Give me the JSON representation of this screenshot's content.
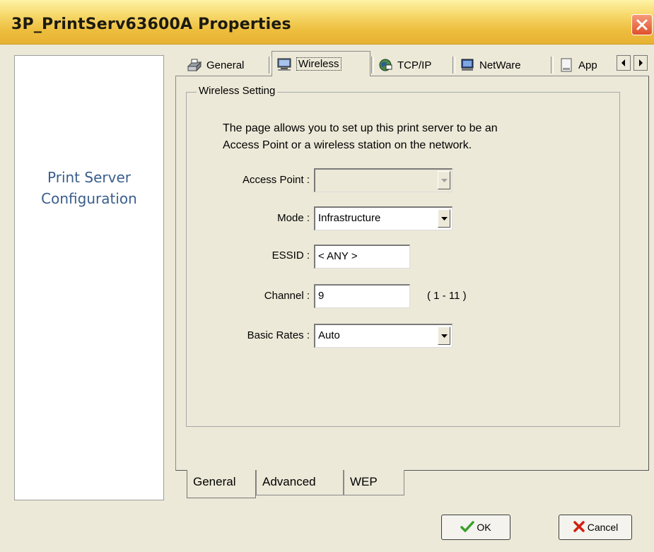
{
  "window": {
    "title": "3P_PrintServ63600A Properties"
  },
  "banner": {
    "line1": "Print Server",
    "line2": "Configuration"
  },
  "tabs": [
    {
      "label": "General",
      "icon": "printer-icon"
    },
    {
      "label": "Wireless",
      "icon": "computer-icon",
      "active": true
    },
    {
      "label": "TCP/IP",
      "icon": "network-globe-icon"
    },
    {
      "label": "NetWare",
      "icon": "netware-icon"
    },
    {
      "label": "App",
      "icon": "document-icon"
    }
  ],
  "wireless": {
    "group_label": "Wireless Setting",
    "description_line1": "The page allows you to set up this print server to be an",
    "description_line2": "Access Point or a wireless station on the network.",
    "access_point": {
      "label": "Access Point :",
      "value": ""
    },
    "mode": {
      "label": "Mode :",
      "value": "Infrastructure"
    },
    "essid": {
      "label": "ESSID :",
      "value": "< ANY >"
    },
    "channel": {
      "label": "Channel :",
      "value": "9",
      "hint": "( 1 - 11 )"
    },
    "basic_rates": {
      "label": "Basic Rates :",
      "value": "Auto"
    }
  },
  "subtabs": [
    {
      "label": "General",
      "active": true
    },
    {
      "label": "Advanced"
    },
    {
      "label": "WEP"
    }
  ],
  "buttons": {
    "ok": "OK",
    "cancel": "Cancel"
  },
  "colors": {
    "title_bar": "#edbd3d",
    "banner_text": "#3a5e8c",
    "ok_check": "#3aa02a",
    "cancel_x": "#d02010"
  }
}
